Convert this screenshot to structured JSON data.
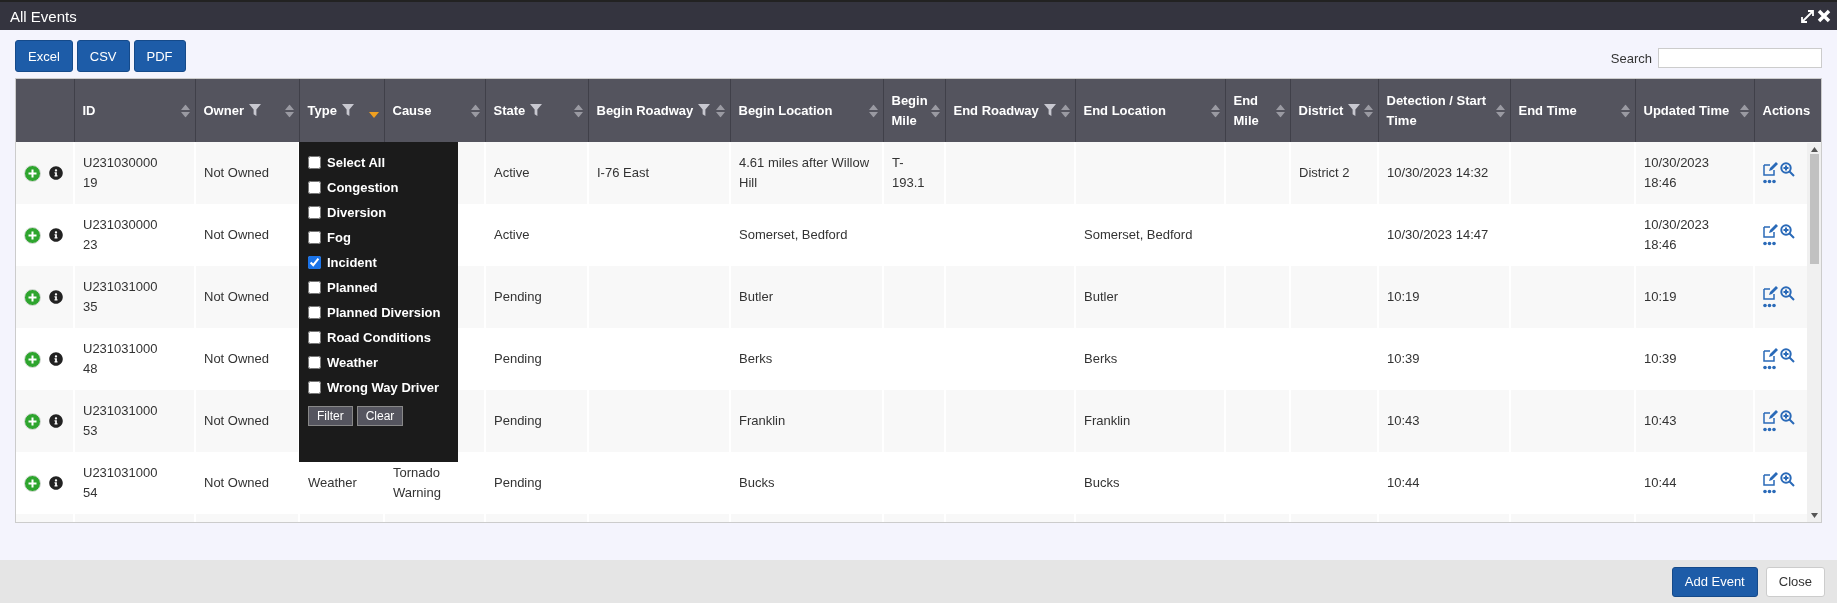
{
  "window": {
    "title": "All Events"
  },
  "export_buttons": [
    "Excel",
    "CSV",
    "PDF"
  ],
  "search": {
    "label": "Search"
  },
  "columns": [
    {
      "sort_icon": false,
      "filter": false
    },
    {
      "label": "ID",
      "sort_icon": true,
      "sorted": false,
      "filter": false
    },
    {
      "label": "Owner",
      "sort_icon": true,
      "sorted": false,
      "filter": true
    },
    {
      "label": "Type",
      "sort_icon": true,
      "sorted": true,
      "filter": true
    },
    {
      "label": "Cause",
      "sort_icon": true,
      "sorted": false,
      "filter": false
    },
    {
      "label": "State",
      "sort_icon": true,
      "sorted": false,
      "filter": true
    },
    {
      "label": "Begin Roadway",
      "sort_icon": true,
      "sorted": false,
      "filter": true
    },
    {
      "label": "Begin Location",
      "sort_icon": true,
      "sorted": false,
      "filter": false
    },
    {
      "label": "Begin Mile",
      "sort_icon": true,
      "sorted": false,
      "filter": false
    },
    {
      "label": "End Roadway",
      "sort_icon": true,
      "sorted": false,
      "filter": true
    },
    {
      "label": "End Location",
      "sort_icon": true,
      "sorted": false,
      "filter": false
    },
    {
      "label": "End Mile",
      "sort_icon": true,
      "sorted": false,
      "filter": false
    },
    {
      "label": "District",
      "sort_icon": true,
      "sorted": false,
      "filter": true
    },
    {
      "label": "Detection / Start Time",
      "sort_icon": true,
      "sorted": false,
      "filter": false
    },
    {
      "label": "End Time",
      "sort_icon": true,
      "sorted": false,
      "filter": false
    },
    {
      "label": "Updated Time",
      "sort_icon": true,
      "sorted": false,
      "filter": false
    },
    {
      "label": "Actions",
      "sort_icon": false,
      "filter": false
    }
  ],
  "rows": [
    {
      "id": "U23103000019",
      "owner": "Not Owned",
      "state": "Active",
      "begin_roadway": "I-76 East",
      "begin_location": "4.61 miles after Willow Hill",
      "begin_mile": "T-193.1",
      "district": "District 2",
      "detection_time": "10/30/2023 14:32",
      "updated_time": "10/30/2023 18:46"
    },
    {
      "id": "U23103000023",
      "owner": "Not Owned",
      "state": "Active",
      "begin_location": "Somerset, Bedford",
      "end_location": "Somerset, Bedford",
      "detection_time": "10/30/2023 14:47",
      "updated_time": "10/30/2023 18:46"
    },
    {
      "id": "U23103100035",
      "owner": "Not Owned",
      "state": "Pending",
      "begin_location": "Butler",
      "end_location": "Butler",
      "detection_time": "10:19",
      "updated_time": "10:19"
    },
    {
      "id": "U23103100048",
      "owner": "Not Owned",
      "state": "Pending",
      "begin_location": "Berks",
      "end_location": "Berks",
      "detection_time": "10:39",
      "updated_time": "10:39"
    },
    {
      "id": "U23103100053",
      "owner": "Not Owned",
      "state": "Pending",
      "begin_location": "Franklin",
      "end_location": "Franklin",
      "detection_time": "10:43",
      "updated_time": "10:43"
    },
    {
      "id": "U23103100054",
      "owner": "Not Owned",
      "type": "Weather",
      "cause": "Tornado Warning",
      "state": "Pending",
      "begin_location": "Bucks",
      "end_location": "Bucks",
      "detection_time": "10:44",
      "updated_time": "10:44"
    }
  ],
  "type_filter": {
    "options": [
      {
        "label": "Select All",
        "checked": false
      },
      {
        "label": "Congestion",
        "checked": false
      },
      {
        "label": "Diversion",
        "checked": false
      },
      {
        "label": "Fog",
        "checked": false
      },
      {
        "label": "Incident",
        "checked": true
      },
      {
        "label": "Planned",
        "checked": false
      },
      {
        "label": "Planned Diversion",
        "checked": false
      },
      {
        "label": "Road Conditions",
        "checked": false
      },
      {
        "label": "Weather",
        "checked": false
      },
      {
        "label": "Wrong Way Driver",
        "checked": false
      }
    ],
    "buttons": [
      "Filter",
      "Clear"
    ]
  },
  "footer_buttons": [
    {
      "label": "Add Event",
      "kind": "primary"
    },
    {
      "label": "Close",
      "kind": "secondary"
    }
  ]
}
